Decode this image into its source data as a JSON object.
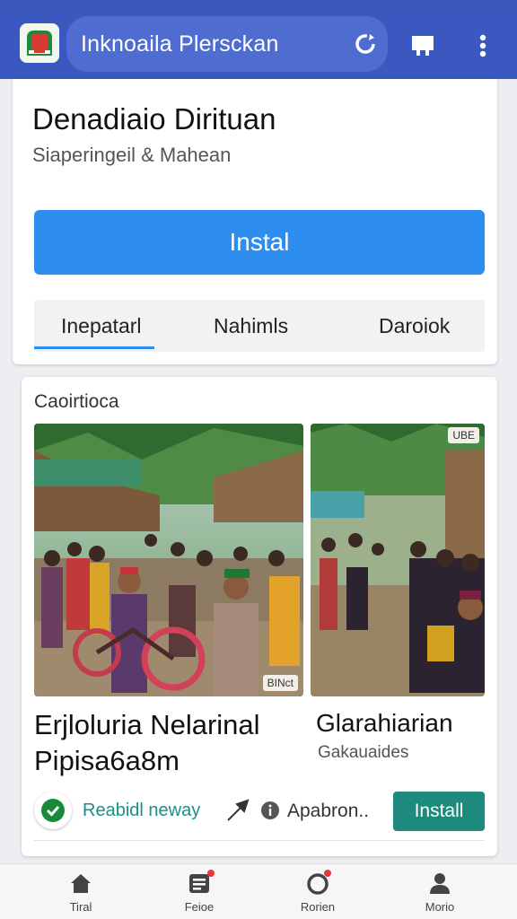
{
  "header": {
    "search_text": "Inknoaila Plersckan",
    "icons": [
      "app-logo",
      "refresh-icon",
      "store-icon",
      "more-vertical-icon"
    ],
    "colors": {
      "bar": "#3b58c0",
      "pill": "#4f6cd0"
    }
  },
  "app": {
    "title": "Denadiaio Dirituan",
    "subtitle": "Siaperingeil & Mahean",
    "install_label": "Instal",
    "accent": "#2d8ef0"
  },
  "tabs": [
    {
      "label": "Inepatarl",
      "selected": true
    },
    {
      "label": "Nahimls",
      "selected": false
    },
    {
      "label": "Daroiok",
      "selected": false
    }
  ],
  "section": {
    "title": "Caoirtioca",
    "photo1_badge": "BINct",
    "photo2_badge": "UBE",
    "card1_title": "Erjloluria Nelarinal Pipisa6a8m",
    "card2_title": "Glarahiarian",
    "card2_subtitle": "Gakauaides",
    "verified_label": "Reabidl neway",
    "info_label": "Apabron..",
    "install_label": "Install",
    "install_color": "#1e8a7e"
  },
  "bottom_nav": [
    {
      "label": "Tiral",
      "icon": "home-icon"
    },
    {
      "label": "Feioe",
      "icon": "apps-icon"
    },
    {
      "label": "Rorien",
      "icon": "circle-badge-icon"
    },
    {
      "label": "Morio",
      "icon": "profile-icon"
    }
  ]
}
